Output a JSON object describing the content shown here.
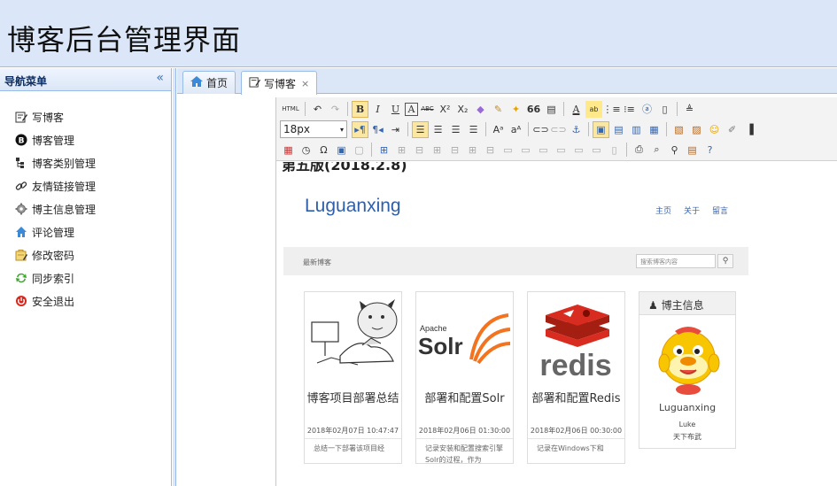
{
  "header": {
    "title": "博客后台管理界面"
  },
  "sidebar": {
    "title": "导航菜单",
    "collapse_glyph": "«",
    "items": [
      {
        "label": "写博客",
        "icon": "edit-icon"
      },
      {
        "label": "博客管理",
        "icon": "blog-icon"
      },
      {
        "label": "博客类别管理",
        "icon": "category-icon"
      },
      {
        "label": "友情链接管理",
        "icon": "link-icon"
      },
      {
        "label": "博主信息管理",
        "icon": "gear-icon"
      },
      {
        "label": "评论管理",
        "icon": "home-icon"
      },
      {
        "label": "修改密码",
        "icon": "password-icon"
      },
      {
        "label": "同步索引",
        "icon": "sync-icon"
      },
      {
        "label": "安全退出",
        "icon": "exit-icon"
      }
    ]
  },
  "tabs": [
    {
      "label": "首页",
      "icon": "home-icon"
    },
    {
      "label": "写博客",
      "icon": "edit-icon",
      "active": true,
      "close": "×"
    }
  ],
  "editor": {
    "font_size": "18px",
    "html_label": "HTML",
    "doc_cut_title": "第五版(2018.2.8)",
    "blog": {
      "brand": "Luguanxing",
      "nav": [
        "主页",
        "关于",
        "留言"
      ],
      "bar_text": "最新博客",
      "search_placeholder": "搜索博客内容",
      "cards": [
        {
          "title": "博客项目部署总结",
          "date": "2018年02月07日 10:47:47",
          "desc": "总结一下部署该项目经"
        },
        {
          "title": "部署和配置Solr",
          "date": "2018年02月06日 01:30:00",
          "desc": "记录安装和配置搜索引擎Solr的过程，作为"
        },
        {
          "title": "部署和配置Redis",
          "date": "2018年02月06日 00:30:00",
          "desc": "记录在Windows下和"
        }
      ],
      "blogger": {
        "head": "博主信息",
        "name": "Luguanxing",
        "nick": "Luke",
        "motto": "天下布武"
      },
      "logos": {
        "solr_small": "Apache",
        "solr_big": "Solr",
        "redis": "redis"
      }
    }
  },
  "colors": {
    "header_bg": "#dbe7f8",
    "border": "#99bbe8",
    "brand": "#2e5fa8",
    "solr_orange": "#f3731f",
    "redis_red": "#d82c20"
  }
}
